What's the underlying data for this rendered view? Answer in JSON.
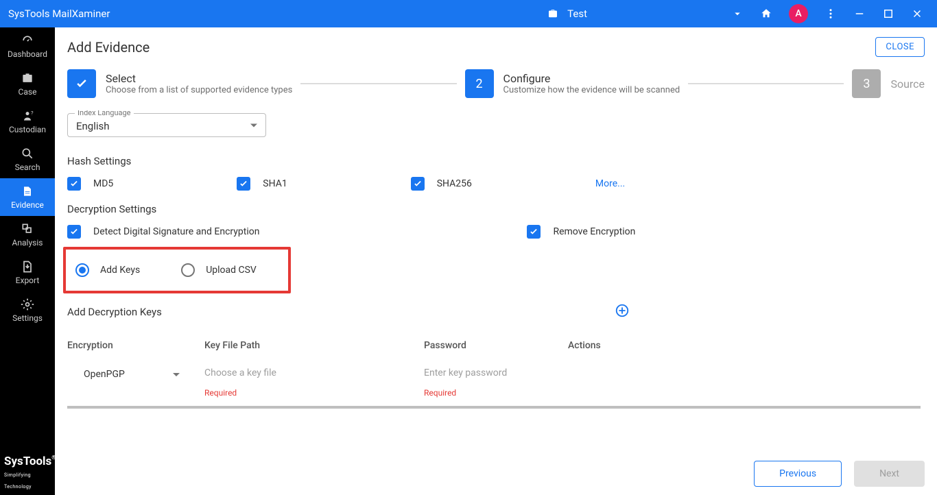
{
  "titlebar": {
    "app_name": "SysTools MailXaminer",
    "case_name": "Test",
    "avatar_letter": "A"
  },
  "sidebar": {
    "items": [
      {
        "label": "Dashboard"
      },
      {
        "label": "Case"
      },
      {
        "label": "Custodian"
      },
      {
        "label": "Search"
      },
      {
        "label": "Evidence"
      },
      {
        "label": "Analysis"
      },
      {
        "label": "Export"
      },
      {
        "label": "Settings"
      }
    ],
    "brand": "SysTools",
    "brand_sub": "Simplifying Technology"
  },
  "page": {
    "title": "Add Evidence",
    "close_label": "CLOSE"
  },
  "stepper": {
    "step1": {
      "title": "Select",
      "desc": "Choose from a list of supported evidence types"
    },
    "step2": {
      "num": "2",
      "title": "Configure",
      "desc": "Customize how the evidence will be scanned"
    },
    "step3": {
      "num": "3",
      "title": "Source"
    }
  },
  "index_lang": {
    "label": "Index Language",
    "value": "English"
  },
  "hash": {
    "title": "Hash Settings",
    "md5": "MD5",
    "sha1": "SHA1",
    "sha256": "SHA256",
    "more": "More..."
  },
  "decrypt": {
    "title": "Decryption Settings",
    "detect": "Detect Digital Signature and Encryption",
    "remove": "Remove Encryption",
    "add_keys": "Add Keys",
    "upload_csv": "Upload CSV",
    "add_decrypt_keys": "Add Decryption Keys"
  },
  "table": {
    "headers": {
      "enc": "Encryption",
      "key": "Key File Path",
      "pass": "Password",
      "act": "Actions"
    },
    "row": {
      "enc_value": "OpenPGP",
      "key_placeholder": "Choose a key file",
      "pass_placeholder": "Enter key password",
      "required": "Required"
    }
  },
  "footer": {
    "previous": "Previous",
    "next": "Next"
  }
}
